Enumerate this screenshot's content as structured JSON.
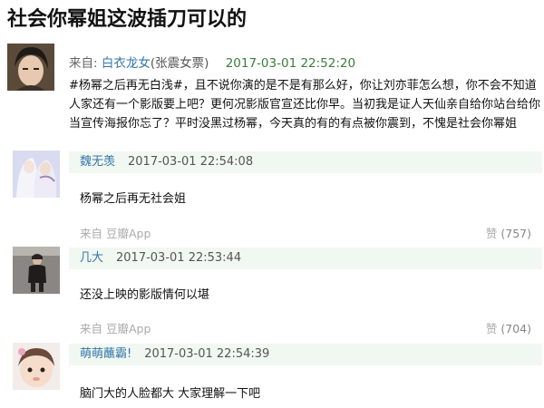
{
  "page": {
    "title": "社会你幂姐这波插刀可以的"
  },
  "post": {
    "from_label": "来自:",
    "author": "白衣龙女",
    "handle": "(张震女票)",
    "time": "2017-03-01 22:52:20",
    "body": "#杨幂之后再无白浅#，且不说你演的是不是有那么好，你让刘亦菲怎么想，你不会不知道人家还有一个影版要上吧？更何况影版官宣还比你早。当初我是证人天仙亲自给你站台给你当宣传海报你忘了？平时没黑过杨幂，今天真的有的有点被你震到，不愧是社会你幂姐"
  },
  "comments": [
    {
      "name": "魏无羡",
      "time": "2017-03-01 22:54:08",
      "text": "杨幂之后再无社会姐",
      "source": "来自 豆瓣App",
      "like_label": "赞",
      "like_count": "(757)"
    },
    {
      "name": "几大",
      "time": "2017-03-01 22:53:44",
      "text": "还没上映的影版情何以堪",
      "source": "来自 豆瓣App",
      "like_label": "赞",
      "like_count": "(704)"
    },
    {
      "name": "萌萌蘸霸!",
      "time": "2017-03-01 22:54:39",
      "text": "脑门大的人脸都大 大家理解一下吧",
      "source": "",
      "like_label": "",
      "like_count": ""
    }
  ]
}
